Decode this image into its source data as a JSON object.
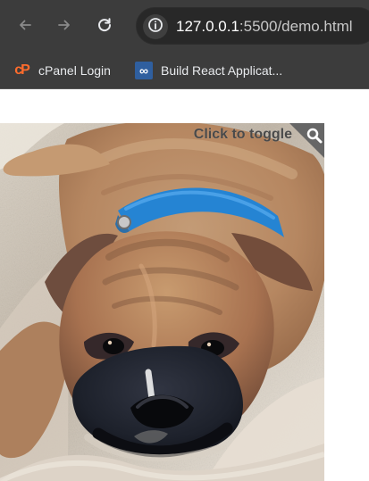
{
  "browser": {
    "address_bar": {
      "host": "127.0.0.1",
      "port_and_path": ":5500/demo.html"
    },
    "icons": {
      "back": "back-arrow-icon",
      "forward": "forward-arrow-icon",
      "reload": "reload-icon",
      "site_info": "site-info-icon"
    },
    "bookmarks": [
      {
        "label": "cPanel Login",
        "icon": "cpanel-icon",
        "icon_glyph": "cP",
        "color": "#ff6c2c"
      },
      {
        "label": "Build React Applicat...",
        "icon": "react-app-icon",
        "icon_glyph": "∞",
        "color": "#2f5f9f"
      }
    ]
  },
  "content": {
    "image": {
      "subject": "boxer puppy lying on sand",
      "overlay_text": "Click to toggle",
      "overlay_icon": "search-icon"
    }
  },
  "colors": {
    "browser_chrome": "#3c3c3c",
    "omnibox": "#282828",
    "toggle_text": "#4a4a4a",
    "collar": "#2b87d8"
  }
}
